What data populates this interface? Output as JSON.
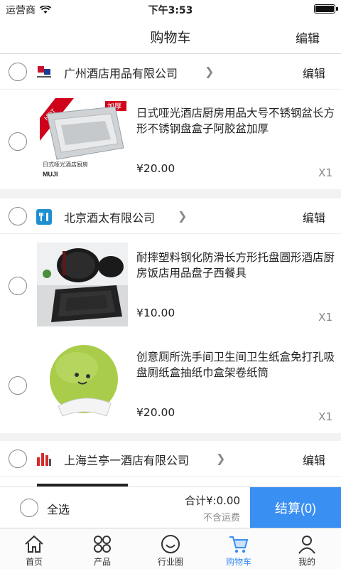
{
  "status_bar": {
    "carrier": "运营商",
    "time": "下午3:53"
  },
  "nav": {
    "title": "购物车",
    "edit_label": "编辑"
  },
  "stores": [
    {
      "name": "广州酒店用品有限公司",
      "edit_label": "编辑",
      "logo_color": "#c8102e",
      "items": [
        {
          "title": "日式哑光酒店厨房用品大号不锈钢盆长方形不锈钢盘盒子阿胶盆加厚",
          "price": "¥20.00",
          "qty": "X1",
          "thumb_labels": {
            "hot": "HOT",
            "thick": "加厚",
            "brand": "MUJI",
            "caption": "日式哑光酒店厨房"
          }
        }
      ]
    },
    {
      "name": "北京酒太有限公司",
      "edit_label": "编辑",
      "logo_color": "#1e90d0",
      "items": [
        {
          "title": "耐摔塑料钢化防滑长方形托盘圆形酒店厨房饭店用品盘子西餐具",
          "price": "¥10.00",
          "qty": "X1"
        },
        {
          "title": "创意厕所洗手间卫生间卫生纸盒免打孔吸盘厕纸盒抽纸巾盒架卷纸筒",
          "price": "¥20.00",
          "qty": "X1"
        }
      ]
    },
    {
      "name": "上海兰亭一酒店有限公司",
      "edit_label": "编辑",
      "logo_color": "#d42a2a",
      "items": []
    }
  ],
  "footer": {
    "select_all_label": "全选",
    "total_label": "合计¥:0.00",
    "shipping_note": "不含运费",
    "checkout_label": "结算(0)"
  },
  "tabs": [
    {
      "label": "首页",
      "icon": "home-icon"
    },
    {
      "label": "产品",
      "icon": "grid-icon"
    },
    {
      "label": "行业圈",
      "icon": "smile-icon"
    },
    {
      "label": "购物车",
      "icon": "cart-icon",
      "active": true
    },
    {
      "label": "我的",
      "icon": "user-icon"
    }
  ],
  "colors": {
    "accent": "#3a8ff2",
    "background": "#f2f2f2"
  }
}
